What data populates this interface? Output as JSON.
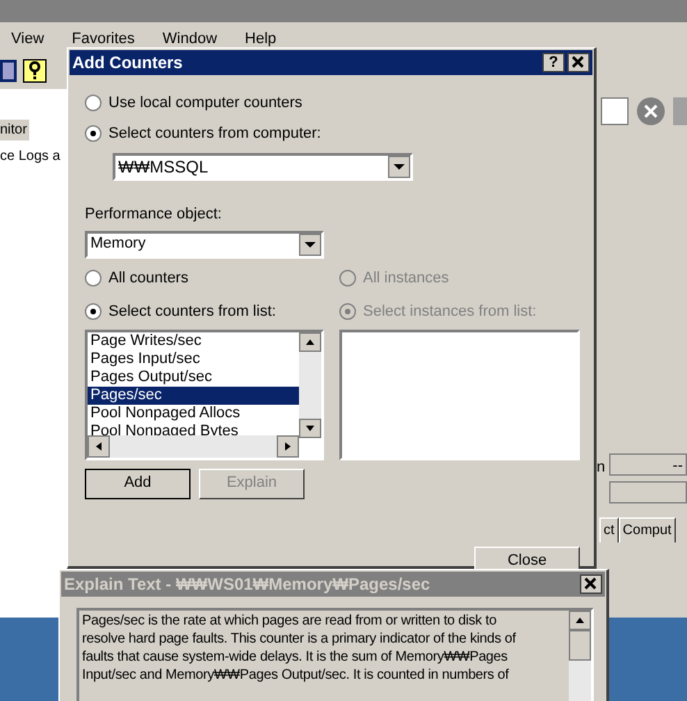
{
  "app": {
    "menu": [
      "View",
      "Favorites",
      "Window",
      "Help"
    ],
    "tree": [
      {
        "label": "nitor",
        "selected": true
      },
      {
        "label": "ce Logs a",
        "selected": false
      }
    ],
    "side_label": "n",
    "side_value": "--",
    "tabs": [
      "ct",
      "Comput"
    ]
  },
  "add_counters": {
    "title": "Add Counters",
    "help_button": "?",
    "source": [
      {
        "label": "Use local computer counters",
        "selected": false
      },
      {
        "label": "Select counters from computer:",
        "selected": true
      }
    ],
    "computer": "₩₩MSSQL",
    "object_label": "Performance object:",
    "object": "Memory",
    "counter_mode": [
      {
        "label": "All counters",
        "selected": false
      },
      {
        "label": "Select counters from list:",
        "selected": true
      }
    ],
    "counters": [
      {
        "label": "Page Writes/sec",
        "selected": false
      },
      {
        "label": "Pages Input/sec",
        "selected": false
      },
      {
        "label": "Pages Output/sec",
        "selected": false
      },
      {
        "label": "Pages/sec",
        "selected": true
      },
      {
        "label": "Pool Nonpaged Allocs",
        "selected": false
      },
      {
        "label": "Pool Nonpaged Bytes",
        "selected": false
      }
    ],
    "instance_mode": [
      {
        "label": "All instances",
        "selected": false,
        "disabled": true
      },
      {
        "label": "Select instances from list:",
        "selected": true,
        "disabled": true
      }
    ],
    "buttons": [
      {
        "label": "Add",
        "disabled": false
      },
      {
        "label": "Explain",
        "disabled": true
      }
    ],
    "close": "Close"
  },
  "explain": {
    "title": "Explain Text - ₩₩WS01₩Memory₩Pages/sec",
    "lines": [
      "Pages/sec is the rate at which pages are read from or written to disk to",
      "resolve hard page faults. This counter is a primary indicator of the kinds of",
      "faults that cause system-wide delays.  It is the sum of Memory₩₩Pages",
      "Input/sec and Memory₩₩Pages Output/sec.  It is counted in numbers of"
    ]
  }
}
